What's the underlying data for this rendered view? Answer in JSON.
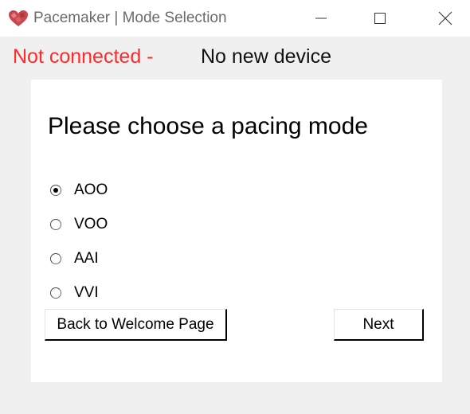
{
  "window": {
    "title": "Pacemaker | Mode Selection",
    "icon": "heart-icon",
    "controls": [
      "minimize-icon",
      "maximize-icon",
      "close-icon"
    ]
  },
  "status": {
    "connection": "Not connected -",
    "device": "No new device",
    "connection_color": "#ff2a2a"
  },
  "panel": {
    "heading": "Please choose a pacing mode",
    "modes": [
      {
        "label": "AOO",
        "checked": true
      },
      {
        "label": "VOO",
        "checked": false
      },
      {
        "label": "AAI",
        "checked": false
      },
      {
        "label": "VVI",
        "checked": false
      }
    ],
    "back_label": "Back to Welcome Page",
    "next_label": "Next"
  }
}
